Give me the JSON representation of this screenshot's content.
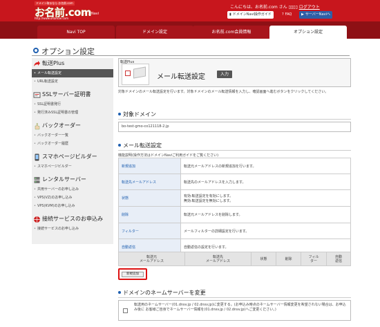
{
  "header": {
    "tagline": "ドメイン取るなら お名前.com",
    "logo": "お名前.com",
    "url": "http://www.onamae.com",
    "sub": "ドメインNavi",
    "greeting": "こんにちは、お名前.com さん",
    "logout": "ログアウト",
    "guide_label": "ドメインNavi操作ガイド",
    "faq_label": "FAQ",
    "svguide_label": "サーバーNaviへ"
  },
  "tabs": [
    {
      "label": "Navi TOP"
    },
    {
      "label": "ドメイン設定"
    },
    {
      "label": "お名前.com会員情報"
    },
    {
      "label": "オプション設定"
    }
  ],
  "page_title": "オプション設定",
  "sidebar": [
    {
      "head": "転送Plus",
      "items": [
        "メール転送設定",
        "URL転送設定"
      ]
    },
    {
      "head": "SSLサーバー証明書",
      "items": [
        "SSL証明書発行",
        "発行済みSSL証明書の管理"
      ]
    },
    {
      "head": "バックオーダー",
      "items": [
        "バックオーダー一覧",
        "バックオーダー履歴"
      ]
    },
    {
      "head": "スマホページビルダー",
      "items": [
        "スマホページビルダー"
      ]
    },
    {
      "head": "レンタルサーバー",
      "items": [
        "共用サーバーのお申し込み",
        "VPS(VZ)のお申し込み",
        "VPS(KVM)のお申し込み"
      ]
    },
    {
      "head": "接続サービスのお申込み",
      "items": [
        "接続サービスのお申し込み"
      ]
    }
  ],
  "service": {
    "tag": "転送Plus",
    "title": "メール転送設定",
    "badge": "入力",
    "description": "対象ドメインのメール転送設定を行います。対象ドメインのメール転送情報を入力し、確認画面へ進むボタンをクリックしてください。"
  },
  "target": {
    "heading": "対象ドメイン",
    "domain": "bo-test-gmo-co121118-2.jp"
  },
  "mail_setting": {
    "heading": "メール転送設定",
    "note": "機能説明(操作方法はドメインNaviご利用ガイドをご覧ください)",
    "functions": [
      {
        "name": "新規追加",
        "desc": "転送元メールアドレスの新規追加を行います。"
      },
      {
        "name": "転送先メールアドレス",
        "desc": "転送先のメールアドレスを入力します。"
      },
      {
        "name": "状態",
        "desc": "有効:転送設定を有効にします。",
        "desc2": "無効:転送設定を無効にします。"
      },
      {
        "name": "削除",
        "desc": "転送元メールアドレスを削除します。"
      },
      {
        "name": "フィルター",
        "desc": "メールフィルターの詳細設定を行います。"
      },
      {
        "name": "自動返信",
        "desc": "自動返信の設定を行います。"
      }
    ],
    "columns": [
      {
        "l1": "転送元",
        "l2": "メールアドレス"
      },
      {
        "l1": "転送先",
        "l2": "メールアドレス"
      },
      {
        "l1": "状態",
        "l2": ""
      },
      {
        "l1": "削除",
        "l2": ""
      },
      {
        "l1": "フィル",
        "l2": "ター"
      },
      {
        "l1": "自動",
        "l2": "返信"
      }
    ],
    "new_button": "新規追加"
  },
  "nameserver": {
    "heading": "ドメインのネームサーバーを変更",
    "text": "転送用のネームサーバー(01.dnsv.jp / 02.dnsv.jp)に変更する。(お申込み時点のネームサーバー情報変更を希望されない場合は、お申込み後に お客様ご自身でネームサーバー情報を(01.dnsv.jp / 02.dnsv.jp)へご変更ください。)"
  }
}
